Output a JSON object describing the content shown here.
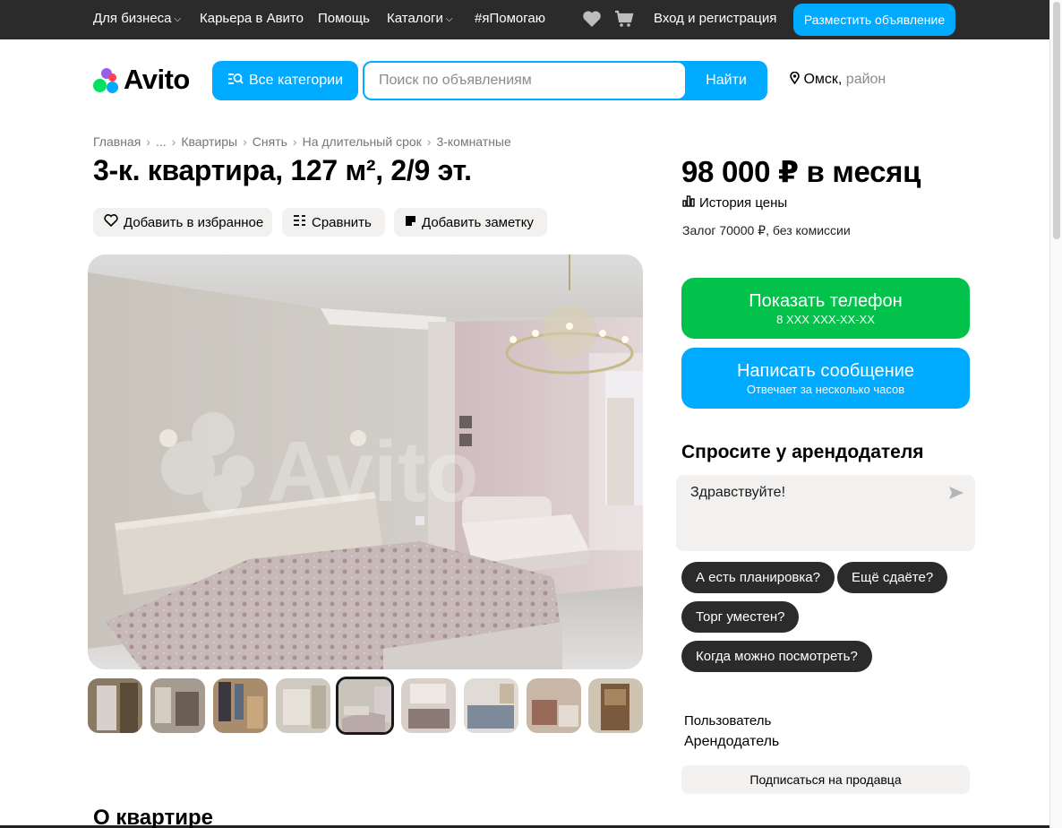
{
  "topbar": {
    "business": "Для бизнеса",
    "career": "Карьера в Авито",
    "help": "Помощь",
    "catalogs": "Каталоги",
    "help_hashtag": "#яПомогаю",
    "login": "Вход и регистрация",
    "post_ad": "Разместить объявление"
  },
  "header": {
    "logo_text": "Avito",
    "categories_button": "Все категории",
    "search_placeholder": "Поиск по объявлениям",
    "search_button": "Найти",
    "city": "Омск,",
    "district": "район"
  },
  "breadcrumb": [
    "Главная",
    "...",
    "Квартиры",
    "Снять",
    "На длительный срок",
    "3-комнатные"
  ],
  "listing": {
    "title": "3-к. квартира, 127 м², 2/9 эт.",
    "actions": {
      "favorite": "Добавить в избранное",
      "compare": "Сравнить",
      "note": "Добавить заметку"
    },
    "photo_watermark": "Avito",
    "about_heading": "О квартире"
  },
  "sidebar": {
    "price": "98 000 ₽ в месяц",
    "price_history": "История цены",
    "deposit": "Залог 70000 ₽, без комиссии",
    "phone_button": "Показать телефон",
    "phone_masked": "8 XXX XXX-XX-XX",
    "message_button": "Написать сообщение",
    "message_sub": "Отвечает за несколько часов",
    "ask_title": "Спросите у арендодателя",
    "ask_default": "Здравствуйте!",
    "quick_questions": [
      "А есть планировка?",
      "Ещё сдаёте?",
      "Торг уместен?",
      "Когда можно посмотреть?"
    ],
    "seller_name": "Пользователь",
    "seller_role": "Арендодатель",
    "subscribe": "Подписаться на продавца"
  },
  "colors": {
    "accent_blue": "#00aaff",
    "phone_green": "#02c24c",
    "topbar_bg": "#2b2b2b",
    "chip_bg": "#2b2b2b",
    "soft_bg": "#f2f1f0"
  },
  "gallery": {
    "thumbnail_count": 9,
    "active_thumbnail": 5
  }
}
